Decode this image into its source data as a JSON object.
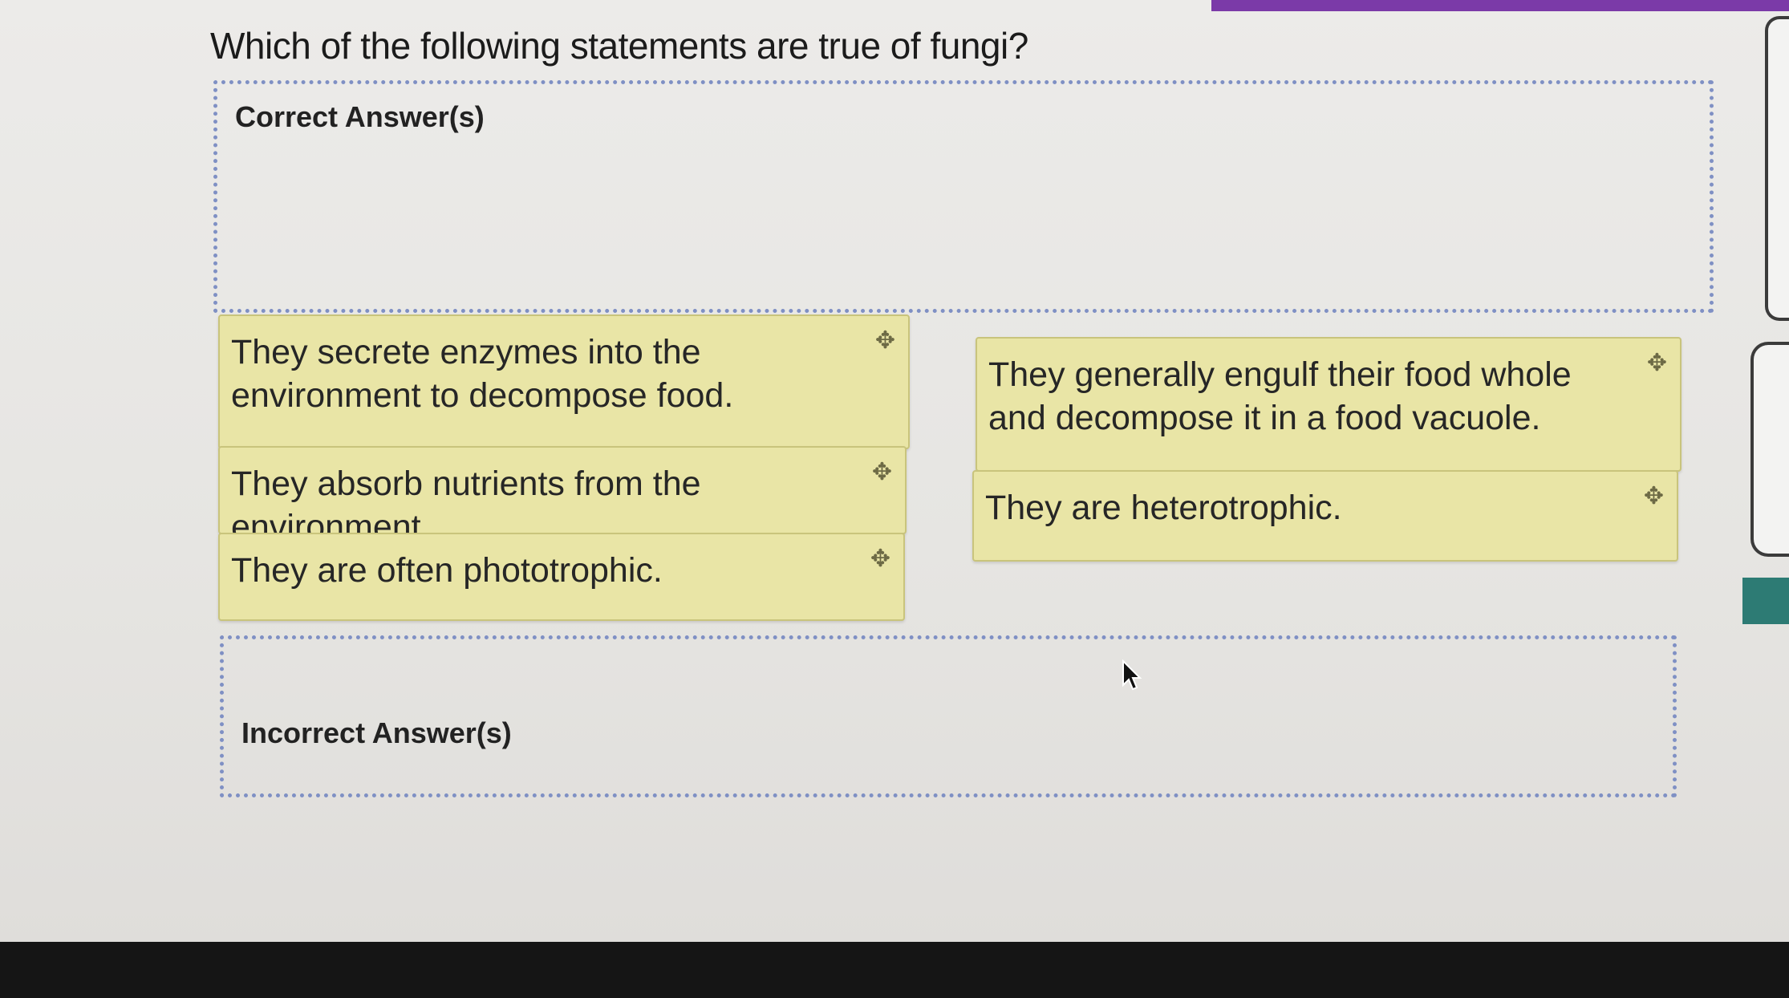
{
  "question": {
    "text": "Which of the following statements are true of fungi?"
  },
  "zones": {
    "correct_label": "Correct Answer(s)",
    "incorrect_label": "Incorrect Answer(s)"
  },
  "cards": [
    {
      "text": "They secrete enzymes into the environment to decompose food.",
      "icon": "move-icon"
    },
    {
      "text": "They absorb nutrients from the environment.",
      "icon": "move-icon"
    },
    {
      "text": "They are often phototrophic.",
      "icon": "move-icon"
    },
    {
      "text": "They generally engulf their food whole and decompose it in a food vacuole.",
      "icon": "move-icon"
    },
    {
      "text": "They are heterotrophic.",
      "icon": "move-icon"
    }
  ],
  "colors": {
    "card_background": "#e9e5a6",
    "dropzone_border": "#7f90c4",
    "accent_purple": "#7b3aa8",
    "accent_teal": "#2d7b74"
  }
}
